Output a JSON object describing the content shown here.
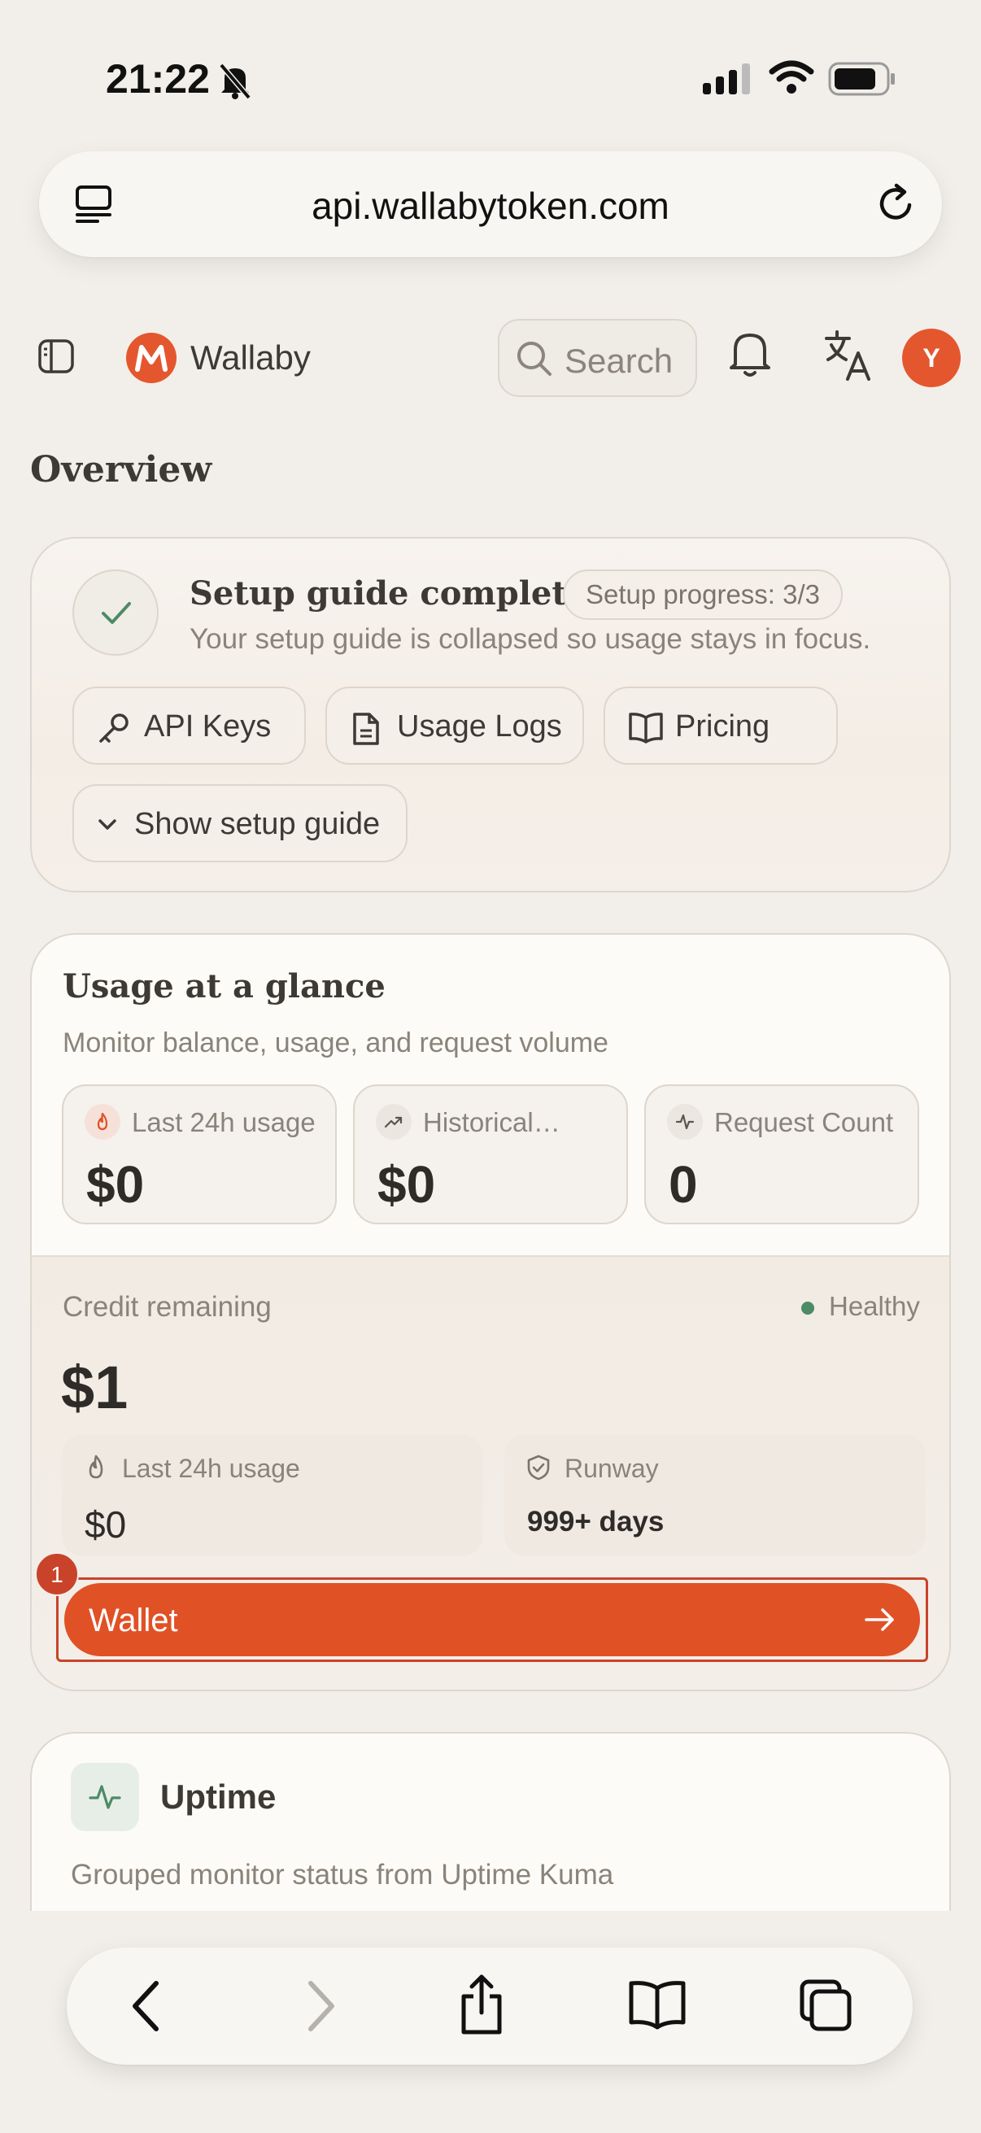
{
  "status_bar": {
    "time": "21:22"
  },
  "browser": {
    "url": "api.wallabytoken.com"
  },
  "header": {
    "brand": "Wallaby",
    "search_placeholder": "Search",
    "avatar_initial": "Y",
    "accent_color": "#e4572e"
  },
  "page": {
    "title": "Overview"
  },
  "setup": {
    "title": "Setup guide complete",
    "progress_badge": "Setup progress: 3/3",
    "description": "Your setup guide is collapsed so usage stays in focus.",
    "buttons": {
      "api_keys": "API Keys",
      "usage_logs": "Usage Logs",
      "pricing": "Pricing",
      "show_guide": "Show setup guide"
    }
  },
  "usage": {
    "title": "Usage at a glance",
    "subtitle": "Monitor balance, usage, and request volume",
    "stats": [
      {
        "label": "Last 24h usage",
        "value": "$0",
        "icon": "flame-icon"
      },
      {
        "label": "Historical…",
        "value": "$0",
        "icon": "trending-up-icon"
      },
      {
        "label": "Request Count",
        "value": "0",
        "icon": "activity-icon"
      }
    ],
    "credit": {
      "label": "Credit remaining",
      "value": "$1",
      "health": "Healthy",
      "health_color": "#4d8b66",
      "last24_label": "Last 24h usage",
      "last24_value": "$0",
      "runway_label": "Runway",
      "runway_value": "999+ days"
    },
    "wallet_button": "Wallet",
    "wallet_badge": "1"
  },
  "uptime": {
    "title": "Uptime",
    "description": "Grouped monitor status from Uptime Kuma"
  }
}
